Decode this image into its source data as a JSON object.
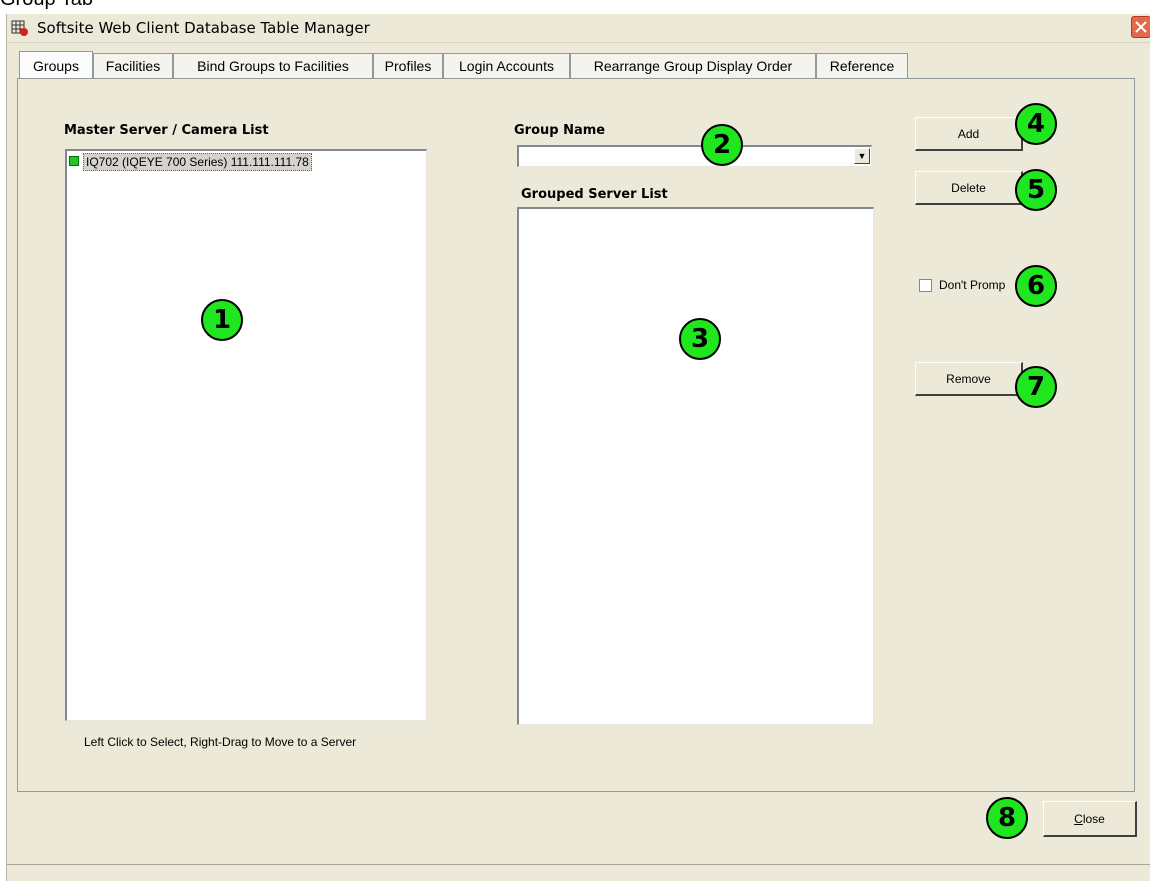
{
  "caption": "Group Tab",
  "window": {
    "title": "Softsite Web Client Database Table Manager"
  },
  "tabs": [
    {
      "label": "Groups"
    },
    {
      "label": "Facilities"
    },
    {
      "label": "Bind Groups to Facilities"
    },
    {
      "label": "Profiles"
    },
    {
      "label": "Login Accounts"
    },
    {
      "label": "Rearrange Group Display Order"
    },
    {
      "label": "Reference"
    }
  ],
  "master_list": {
    "label": "Master Server / Camera List",
    "items": [
      {
        "text": "IQ702 (IQEYE 700 Series) 111.111.111.78",
        "status_color": "#1ec81e"
      }
    ],
    "hint": "Left Click to Select, Right-Drag to Move to a Server"
  },
  "group_name": {
    "label": "Group Name",
    "value": ""
  },
  "grouped_list": {
    "label": "Grouped Server List",
    "items": []
  },
  "buttons": {
    "add": "Add",
    "delete": "Delete",
    "remove": "Remove",
    "close_first": "C",
    "close_rest": "lose"
  },
  "dont_prompt": {
    "label": "Don't Promp",
    "checked": false
  },
  "callouts": [
    "1",
    "2",
    "3",
    "4",
    "5",
    "6",
    "7",
    "8"
  ],
  "colors": {
    "callout_fill": "#1fe61f",
    "window_bg": "#ece9d8"
  }
}
